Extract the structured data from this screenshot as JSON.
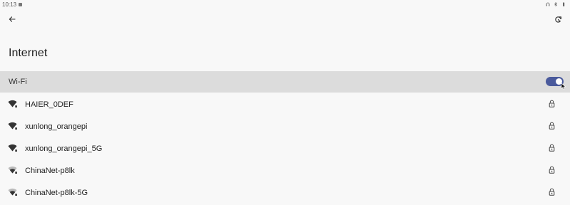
{
  "status_bar": {
    "time": "10:13",
    "icons": [
      "notification-icon",
      "headset-icon",
      "bluetooth-icon",
      "battery-icon"
    ]
  },
  "toolbar": {
    "back_icon": "arrow-left-icon",
    "refresh_icon": "refresh-icon"
  },
  "page": {
    "title": "Internet"
  },
  "wifi": {
    "label": "Wi-Fi",
    "enabled": true,
    "accent_color": "#4a5a9c"
  },
  "networks": [
    {
      "name": "HAIER_0DEF",
      "secured": true
    },
    {
      "name": "xunlong_orangepi",
      "secured": true
    },
    {
      "name": "xunlong_orangepi_5G",
      "secured": true
    },
    {
      "name": "ChinaNet-p8lk",
      "secured": true
    },
    {
      "name": "ChinaNet-p8lk-5G",
      "secured": true
    }
  ]
}
